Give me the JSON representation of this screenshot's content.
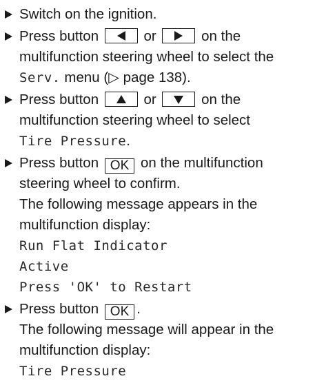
{
  "steps": [
    {
      "text": "Switch on the ignition."
    },
    {
      "pre": "Press button",
      "key_left_icon": "left-arrow-icon",
      "or": "or",
      "key_right_icon": "right-arrow-icon",
      "post_line1": "on the",
      "line2": "multifunction steering wheel to select the",
      "menu": "Serv.",
      "line3_post": "menu (▷ page 138)."
    },
    {
      "pre": "Press button",
      "key_up_icon": "up-arrow-icon",
      "or": "or",
      "key_down_icon": "down-arrow-icon",
      "post_line1": "on the",
      "line2": "multifunction steering wheel to select",
      "menu": "Tire Pressure",
      "menu_suffix": "."
    },
    {
      "pre": "Press button",
      "key": "OK",
      "post_line1": "on the multifunction",
      "line2": "steering wheel to confirm.",
      "line3": "The following message appears in the",
      "line4": "multifunction display:",
      "display": [
        "Run Flat Indicator",
        "Active",
        "Press 'OK' to Restart"
      ]
    },
    {
      "pre": "Press button",
      "key": "OK",
      "key_suffix": ".",
      "line2": "The following message will appear in the",
      "line3": "multifunction display:",
      "display": [
        "Tire Pressure"
      ]
    }
  ]
}
